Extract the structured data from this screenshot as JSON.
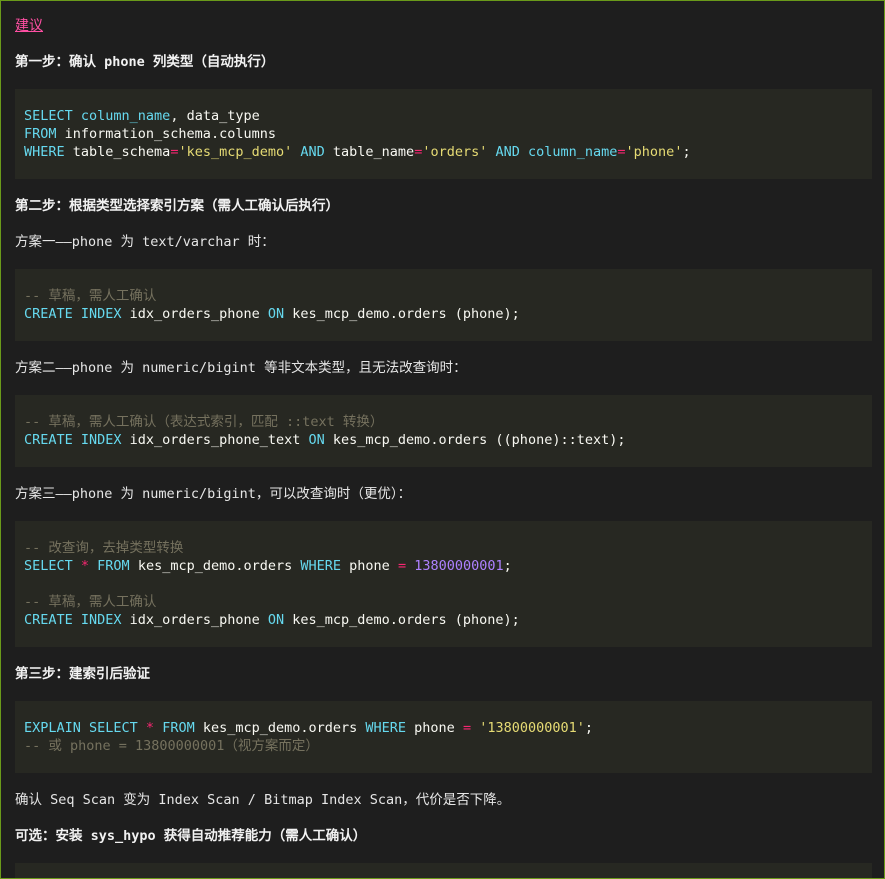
{
  "link": "建议",
  "step1": {
    "heading": "第一步：确认 phone 列类型（自动执行）",
    "code": [
      [
        {
          "t": "kw",
          "v": "SELECT "
        },
        {
          "t": "kw",
          "v": "column_name"
        },
        {
          "t": "tx",
          "v": ", data_type"
        }
      ],
      [
        {
          "t": "kw",
          "v": "FROM "
        },
        {
          "t": "tx",
          "v": "information_schema.columns"
        }
      ],
      [
        {
          "t": "kw",
          "v": "WHERE "
        },
        {
          "t": "tx",
          "v": "table_schema"
        },
        {
          "t": "op",
          "v": "="
        },
        {
          "t": "str",
          "v": "'kes_mcp_demo'"
        },
        {
          "t": "kw",
          "v": " AND "
        },
        {
          "t": "tx",
          "v": "table_name"
        },
        {
          "t": "op",
          "v": "="
        },
        {
          "t": "str",
          "v": "'orders'"
        },
        {
          "t": "kw",
          "v": " AND "
        },
        {
          "t": "kw",
          "v": "column_name"
        },
        {
          "t": "op",
          "v": "="
        },
        {
          "t": "str",
          "v": "'phone'"
        },
        {
          "t": "tx",
          "v": ";"
        }
      ]
    ]
  },
  "step2": {
    "heading": "第二步：根据类型选择索引方案（需人工确认后执行）",
    "plan1": {
      "text": "方案一——phone 为 text/varchar 时：",
      "code": [
        [
          {
            "t": "cmt",
            "v": "-- 草稿，需人工确认"
          }
        ],
        [
          {
            "t": "kw",
            "v": "CREATE INDEX "
          },
          {
            "t": "tx",
            "v": "idx_orders_phone "
          },
          {
            "t": "kw",
            "v": "ON "
          },
          {
            "t": "tx",
            "v": "kes_mcp_demo.orders (phone);"
          }
        ]
      ]
    },
    "plan2": {
      "text": "方案二——phone 为 numeric/bigint 等非文本类型，且无法改查询时：",
      "code": [
        [
          {
            "t": "cmt",
            "v": "-- 草稿，需人工确认（表达式索引，匹配 ::text 转换）"
          }
        ],
        [
          {
            "t": "kw",
            "v": "CREATE INDEX "
          },
          {
            "t": "tx",
            "v": "idx_orders_phone_text "
          },
          {
            "t": "kw",
            "v": "ON "
          },
          {
            "t": "tx",
            "v": "kes_mcp_demo.orders ((phone)::text);"
          }
        ]
      ]
    },
    "plan3": {
      "text": "方案三——phone 为 numeric/bigint，可以改查询时（更优）：",
      "code": [
        [
          {
            "t": "cmt",
            "v": "-- 改查询，去掉类型转换"
          }
        ],
        [
          {
            "t": "kw",
            "v": "SELECT "
          },
          {
            "t": "op",
            "v": "* "
          },
          {
            "t": "kw",
            "v": "FROM "
          },
          {
            "t": "tx",
            "v": "kes_mcp_demo.orders "
          },
          {
            "t": "kw",
            "v": "WHERE "
          },
          {
            "t": "tx",
            "v": "phone "
          },
          {
            "t": "op",
            "v": "= "
          },
          {
            "t": "num",
            "v": "13800000001"
          },
          {
            "t": "tx",
            "v": ";"
          }
        ],
        [],
        [
          {
            "t": "cmt",
            "v": "-- 草稿，需人工确认"
          }
        ],
        [
          {
            "t": "kw",
            "v": "CREATE INDEX "
          },
          {
            "t": "tx",
            "v": "idx_orders_phone "
          },
          {
            "t": "kw",
            "v": "ON "
          },
          {
            "t": "tx",
            "v": "kes_mcp_demo.orders (phone);"
          }
        ]
      ]
    }
  },
  "step3": {
    "heading": "第三步：建索引后验证",
    "code": [
      [
        {
          "t": "kw",
          "v": "EXPLAIN SELECT "
        },
        {
          "t": "op",
          "v": "* "
        },
        {
          "t": "kw",
          "v": "FROM "
        },
        {
          "t": "tx",
          "v": "kes_mcp_demo.orders "
        },
        {
          "t": "kw",
          "v": "WHERE "
        },
        {
          "t": "tx",
          "v": "phone "
        },
        {
          "t": "op",
          "v": "= "
        },
        {
          "t": "str",
          "v": "'13800000001'"
        },
        {
          "t": "tx",
          "v": ";"
        }
      ],
      [
        {
          "t": "cmt",
          "v": "-- 或 phone = 13800000001（视方案而定）"
        }
      ]
    ],
    "note": "确认 Seq Scan 变为 Index Scan / Bitmap Index Scan，代价是否下降。"
  },
  "optional": {
    "heading": "可选：安装 sys_hypo 获得自动推荐能力（需人工确认）"
  },
  "colors": {
    "keyword": "#66d9ef",
    "string": "#e6db74",
    "comment": "#75715e",
    "operator": "#f92672",
    "number": "#ae81ff",
    "link": "#ff4fa3",
    "code_bg": "#272822",
    "page_bg": "#1e1e1e"
  }
}
